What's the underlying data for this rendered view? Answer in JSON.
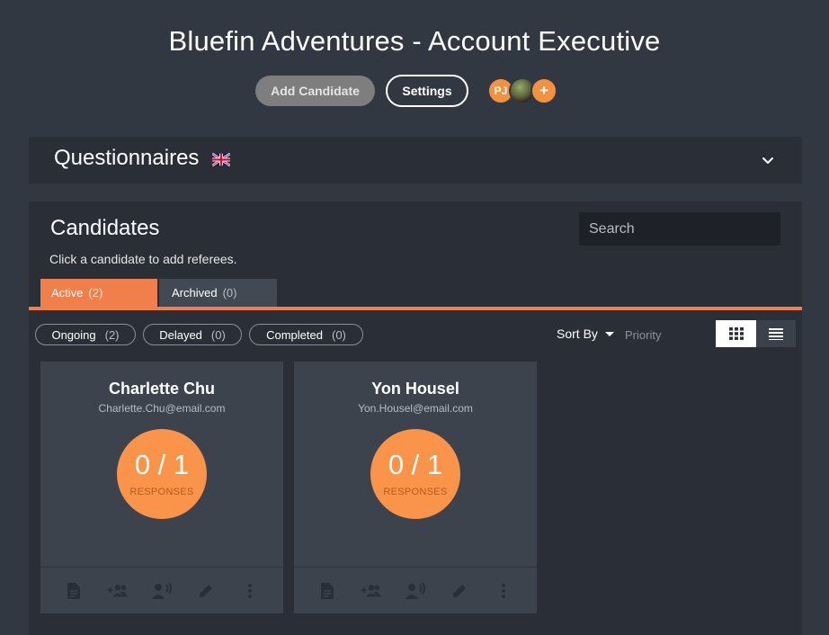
{
  "header": {
    "title": "Bluefin Adventures - Account Executive",
    "add_candidate_label": "Add Candidate",
    "settings_label": "Settings",
    "avatars": [
      {
        "initials": "PJ",
        "color": "#f4913f"
      },
      {
        "initials": "",
        "type": "photo"
      },
      {
        "initials": "+",
        "type": "add",
        "color": "#f4913f"
      }
    ]
  },
  "questionnaires": {
    "title": "Questionnaires",
    "flag_icon": "uk-flag-icon",
    "expand_icon": "chevron-down-icon"
  },
  "candidates": {
    "title": "Candidates",
    "subtitle": "Click a candidate to add referees.",
    "search_placeholder": "Search",
    "tabs": [
      {
        "label": "Active",
        "count": "(2)",
        "active": true
      },
      {
        "label": "Archived",
        "count": "(0)",
        "active": false
      }
    ],
    "filters": [
      {
        "label": "Ongoing",
        "count": "(2)"
      },
      {
        "label": "Delayed",
        "count": "(0)"
      },
      {
        "label": "Completed",
        "count": "(0)"
      }
    ],
    "sort_label": "Sort By",
    "sort_value": "Priority",
    "views": [
      "grid-view-icon",
      "list-view-icon"
    ],
    "cards": [
      {
        "name": "Charlette Chu",
        "email": "Charlette.Chu@email.com",
        "responses": "0 / 1",
        "responses_label": "RESPONSES"
      },
      {
        "name": "Yon Housel",
        "email": "Yon.Housel@email.com",
        "responses": "0 / 1",
        "responses_label": "RESPONSES"
      }
    ],
    "card_action_icons": [
      "document-icon",
      "add-referee-icon",
      "request-feedback-icon",
      "edit-icon",
      "more-options-icon"
    ]
  },
  "colors": {
    "accent": "#f07f4b",
    "circle": "#f9944a",
    "background": "#323841",
    "panel": "#2a2f37",
    "card": "#3d434c"
  }
}
